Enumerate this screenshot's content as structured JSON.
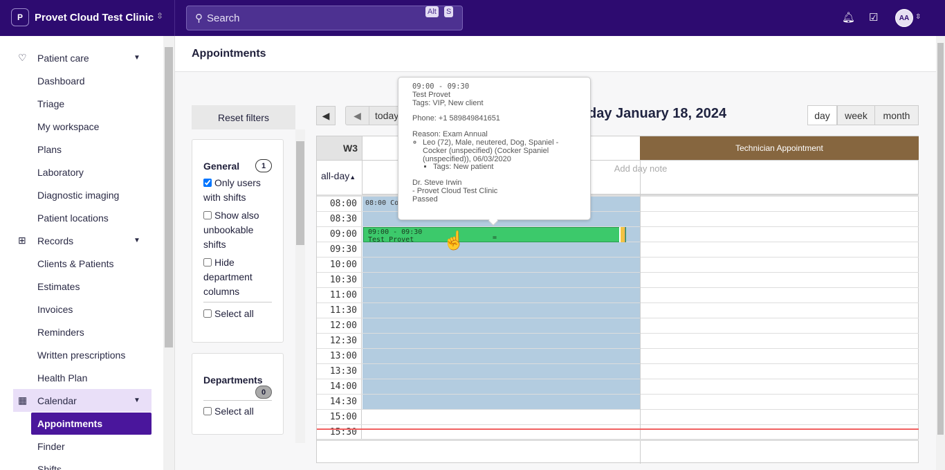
{
  "topbar": {
    "clinic_initial": "P",
    "clinic_name": "Provet Cloud Test Clinic",
    "search_placeholder": "Search",
    "shortcut": [
      "Alt",
      "S"
    ],
    "avatar": "AA"
  },
  "sidebar": {
    "groups": [
      {
        "label": "Patient care",
        "icon": "heart-pulse-icon",
        "items": [
          "Dashboard",
          "Triage",
          "My workspace",
          "Plans",
          "Laboratory",
          "Diagnostic imaging",
          "Patient locations"
        ]
      },
      {
        "label": "Records",
        "icon": "folder-plus-icon",
        "items": [
          "Clients & Patients",
          "Estimates",
          "Invoices",
          "Reminders",
          "Written prescriptions",
          "Health Plan"
        ]
      },
      {
        "label": "Calendar",
        "icon": "calendar-icon",
        "items": [
          "Appointments",
          "Finder",
          "Shifts"
        ]
      }
    ],
    "active": "Appointments"
  },
  "page": {
    "title": "Appointments"
  },
  "filters": {
    "reset": "Reset filters",
    "general": {
      "title": "General",
      "count": "1",
      "options": [
        {
          "label": "Only users with shifts",
          "checked": true
        },
        {
          "label": "Show also unbookable shifts",
          "checked": false
        },
        {
          "label": "Hide department columns",
          "checked": false
        }
      ],
      "select_all": "Select all"
    },
    "departments": {
      "title": "Departments",
      "count": "0",
      "select_all": "Select all"
    }
  },
  "calendar": {
    "today": "today",
    "title": "day January 18, 2024",
    "views": [
      "day",
      "week",
      "month"
    ],
    "active_view": "day",
    "week": "W3",
    "allday": "all-day",
    "add_note": "Add day note",
    "columns": [
      {
        "name": ""
      },
      {
        "name": "Technician Appointment",
        "color": "#86663f"
      }
    ],
    "times": [
      "08:00",
      "08:30",
      "09:00",
      "09:30",
      "10:00",
      "10:30",
      "11:00",
      "11:30",
      "12:00",
      "12:30",
      "13:00",
      "13:30",
      "14:00",
      "14:30",
      "15:00",
      "15:30"
    ],
    "events": [
      {
        "text": "08:00 Co"
      },
      {
        "time": "09:00 - 09:30",
        "title": "Test Provet",
        "mark": "=",
        "color": "#3cc96b"
      }
    ]
  },
  "tooltip": {
    "time": "09:00 - 09:30",
    "client": "Test Provet",
    "tags": "Tags: VIP, New client",
    "phone": "Phone: +1 589849841651",
    "reason": "Reason: Exam Annual",
    "patient": "Leo (72), Male, neutered, Dog, Spaniel - Cocker (unspecified) (Cocker Spaniel (unspecified)), 06/03/2020",
    "patient_tags": "Tags: New patient",
    "doctor": "Dr. Steve Irwin",
    "clinic": "- Provet Cloud Test Clinic",
    "status": "Passed"
  }
}
